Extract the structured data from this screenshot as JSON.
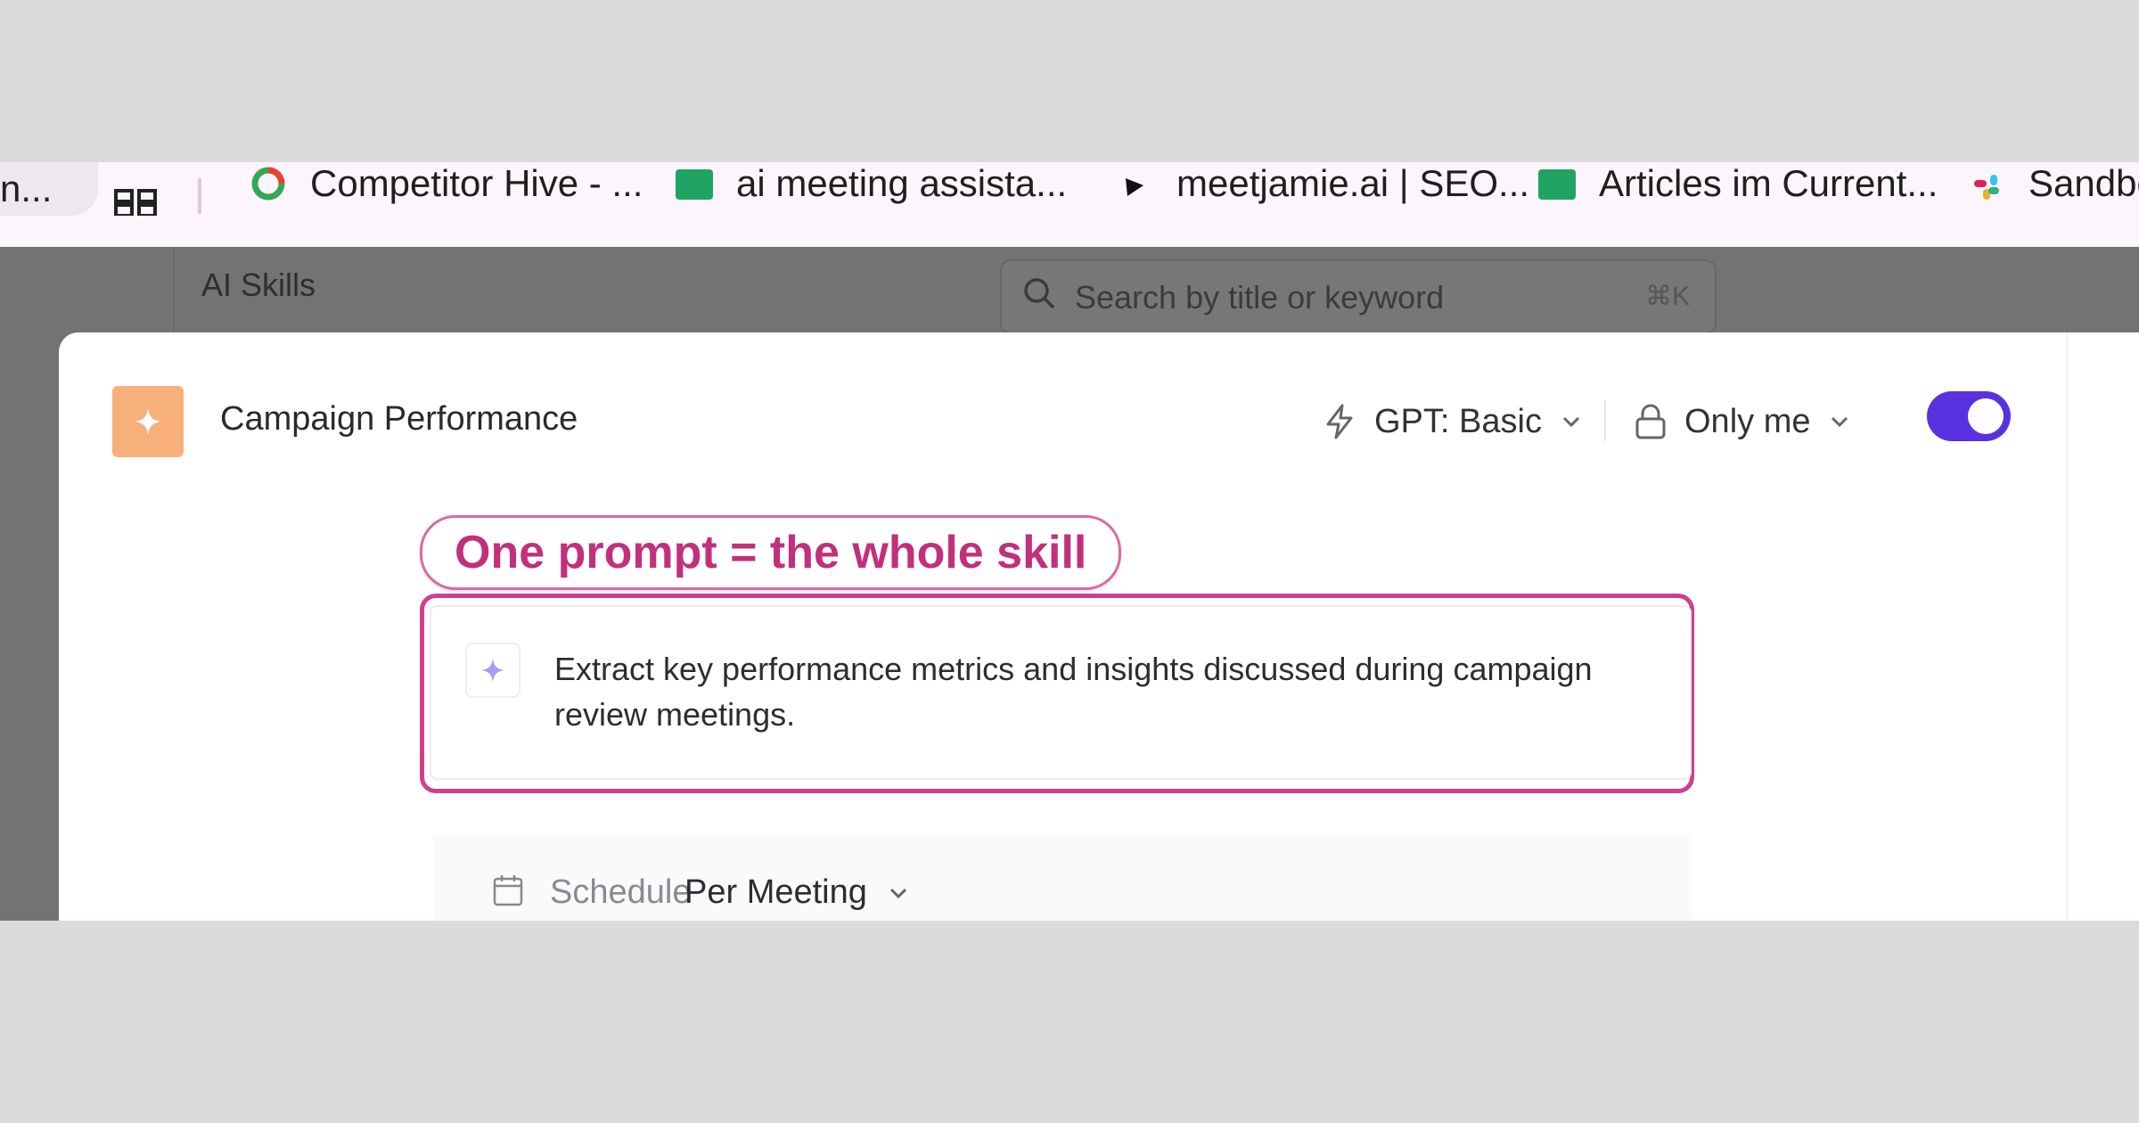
{
  "bookmarks": [
    {
      "label": "n..."
    },
    {
      "label": "Competitor Hive - ..."
    },
    {
      "label": "ai meeting assista..."
    },
    {
      "label": "meetjamie.ai | SEO..."
    },
    {
      "label": "Articles im Current..."
    },
    {
      "label": "Sandbo"
    }
  ],
  "background": {
    "title": "AI Skills",
    "search_placeholder": "Search by title or keyword",
    "search_shortcut": "⌘K"
  },
  "skill": {
    "title": "Campaign Performance",
    "model_label": "GPT: Basic",
    "visibility_label": "Only me",
    "enabled": true,
    "prompt": "Extract key performance metrics and insights discussed during campaign review meetings.",
    "schedule_label": "Schedule",
    "schedule_value": "Per Meeting"
  },
  "annotation": {
    "callout": "One prompt = the whole skill"
  },
  "colors": {
    "accent": "#5a31e0",
    "skill_icon": "#f8b07a",
    "annotation": "#c2307c"
  }
}
